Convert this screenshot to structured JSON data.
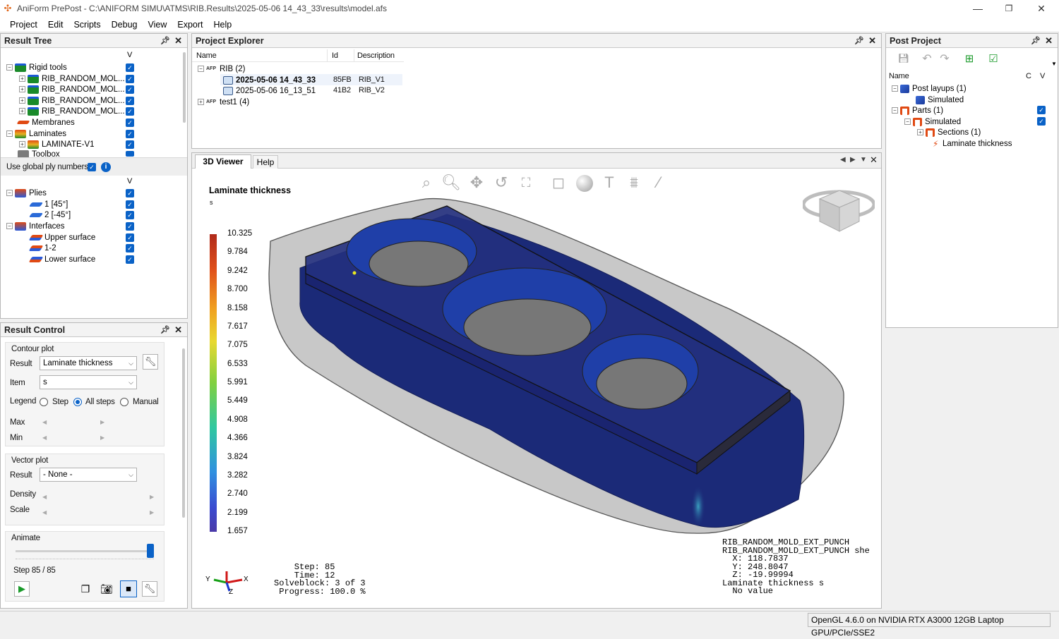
{
  "window": {
    "title": "AniForm PrePost - C:\\ANIFORM SIMU\\ATMS\\RIB.Results\\2025-05-06 14_43_33\\results\\model.afs",
    "minimize": "—",
    "maximize": "❐",
    "close": "✕"
  },
  "menu": [
    "Project",
    "Edit",
    "Scripts",
    "Debug",
    "View",
    "Export",
    "Help"
  ],
  "result_tree": {
    "title": "Result Tree",
    "col_v": "V",
    "items": [
      {
        "label": "Rigid tools"
      },
      {
        "label": "RIB_RANDOM_MOL..."
      },
      {
        "label": "RIB_RANDOM_MOL..."
      },
      {
        "label": "RIB_RANDOM_MOL..."
      },
      {
        "label": "RIB_RANDOM_MOL..."
      },
      {
        "label": "Membranes"
      },
      {
        "label": "Laminates"
      },
      {
        "label": "LAMINATE-V1"
      },
      {
        "label": "Toolbox"
      }
    ],
    "global_ply_label": "Use global ply numbers",
    "plies": [
      {
        "label": "Plies"
      },
      {
        "label": "1 [45°]"
      },
      {
        "label": "2 [-45°]"
      },
      {
        "label": "Interfaces"
      },
      {
        "label": "Upper surface"
      },
      {
        "label": "1-2"
      },
      {
        "label": "Lower surface"
      }
    ]
  },
  "result_control": {
    "title": "Result Control",
    "contour_group": "Contour plot",
    "result_label": "Result",
    "result_value": "Laminate thickness",
    "item_label": "Item",
    "item_value": "s",
    "legend_label": "Legend",
    "legend_options": [
      "Step",
      "All steps",
      "Manual"
    ],
    "legend_selected": "All steps",
    "max_label": "Max",
    "min_label": "Min",
    "vector_group": "Vector plot",
    "vector_result_label": "Result",
    "vector_result_value": "- None -",
    "density_label": "Density",
    "scale_label": "Scale",
    "animate_label": "Animate",
    "step_text": "Step 85 / 85",
    "animate_fraction": 1.0
  },
  "project_explorer": {
    "title": "Project Explorer",
    "columns": [
      "Name",
      "Id",
      "Description"
    ],
    "rows": [
      {
        "name": "RIB (2)",
        "id": "",
        "desc": ""
      },
      {
        "name": "2025-05-06 14_43_33",
        "id": "85FB",
        "desc": "RIB_V1"
      },
      {
        "name": "2025-05-06 16_13_51",
        "id": "41B2",
        "desc": "RIB_V2"
      },
      {
        "name": "test1 (4)",
        "id": "",
        "desc": ""
      }
    ]
  },
  "viewer": {
    "tabs": [
      "3D Viewer",
      "Help"
    ],
    "legend_title": "Laminate thickness",
    "legend_item": "s",
    "legend_values": [
      "10.325",
      "9.784",
      "9.242",
      "8.700",
      "8.158",
      "7.617",
      "7.075",
      "6.533",
      "5.991",
      "5.449",
      "4.908",
      "4.366",
      "3.824",
      "3.282",
      "2.740",
      "2.199",
      "1.657"
    ],
    "step_info": "    Step: 85\n    Time: 12\nSolveblock: 3 of 3\n Progress: 100.0 %",
    "pick_info": "RIB_RANDOM_MOLD_EXT_PUNCH\nRIB_RANDOM_MOLD_EXT_PUNCH she\n  X: 118.7837\n  Y: 248.8047\n  Z: -19.99994\nLaminate thickness s\n  No value",
    "axes": {
      "x": "X",
      "y": "Y",
      "z": "Z"
    }
  },
  "post_project": {
    "title": "Post Project",
    "col_name": "Name",
    "col_c": "C",
    "col_v": "V",
    "items": [
      {
        "label": "Post layups (1)"
      },
      {
        "label": "Simulated"
      },
      {
        "label": "Parts (1)"
      },
      {
        "label": "Simulated"
      },
      {
        "label": "Sections (1)"
      },
      {
        "label": "Laminate thickness"
      }
    ]
  },
  "status": {
    "gl_info": "OpenGL 4.6.0 on NVIDIA RTX A3000 12GB Laptop GPU/PCIe/SSE2"
  },
  "colors": {
    "accent": "#0a62c7",
    "viewer_bg": "#ffffff",
    "part_fill": "#1b2a78"
  }
}
